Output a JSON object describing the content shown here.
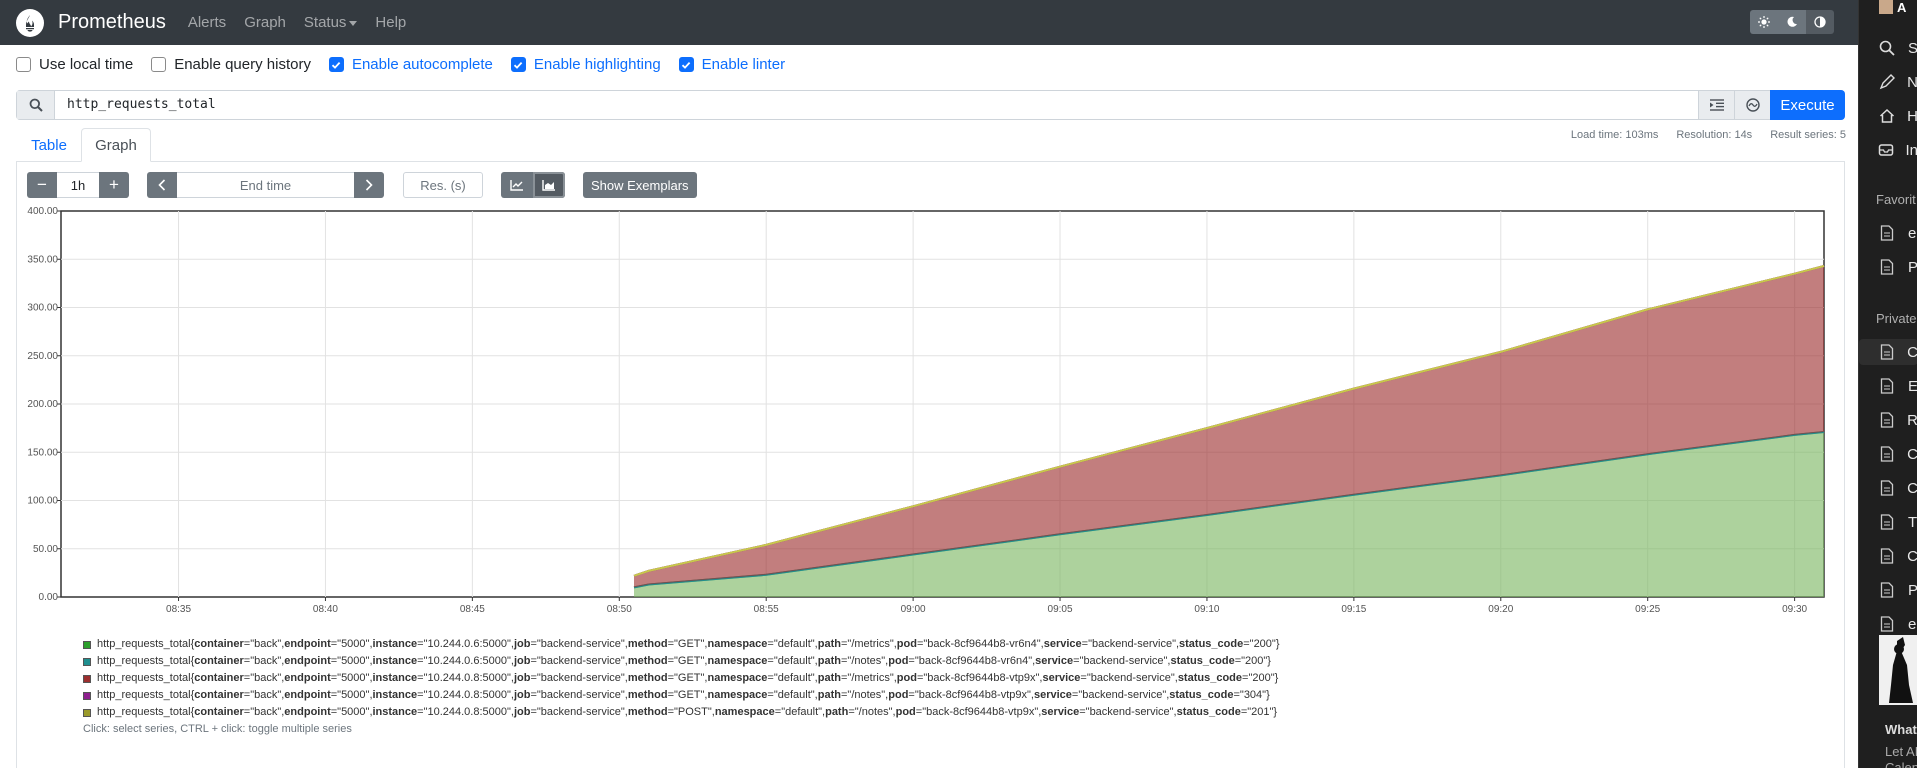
{
  "navbar": {
    "brand": "Prometheus",
    "links": [
      "Alerts",
      "Graph",
      "Status",
      "Help"
    ],
    "theme_icons": [
      "sun-icon",
      "moon-icon",
      "contrast-icon"
    ]
  },
  "options": [
    {
      "label": "Use local time",
      "checked": false
    },
    {
      "label": "Enable query history",
      "checked": false
    },
    {
      "label": "Enable autocomplete",
      "checked": true
    },
    {
      "label": "Enable highlighting",
      "checked": true
    },
    {
      "label": "Enable linter",
      "checked": true
    }
  ],
  "query": {
    "expression": "http_requests_total",
    "execute_label": "Execute"
  },
  "stats": {
    "load_time": "Load time: 103ms",
    "resolution": "Resolution: 14s",
    "result_series": "Result series: 5"
  },
  "tabs": {
    "table": "Table",
    "graph": "Graph"
  },
  "controls": {
    "minus": "−",
    "range": "1h",
    "plus": "+",
    "end_time_placeholder": "End time",
    "resolution_placeholder": "Res. (s)",
    "show_exemplars": "Show Exemplars"
  },
  "chart_data": {
    "type": "area",
    "stacked": true,
    "grid": true,
    "ylim": [
      0,
      400
    ],
    "yticks": [
      "0.00",
      "50.00",
      "100.00",
      "150.00",
      "200.00",
      "250.00",
      "300.00",
      "350.00",
      "400.00"
    ],
    "xlim": [
      "08:31",
      "09:31"
    ],
    "xticks": [
      "08:35",
      "08:40",
      "08:45",
      "08:50",
      "08:55",
      "09:00",
      "09:05",
      "09:10",
      "09:15",
      "09:20",
      "09:25",
      "09:30"
    ],
    "x": [
      "08:50:30",
      "08:51",
      "08:55",
      "09:00",
      "09:05",
      "09:10",
      "09:15",
      "09:20",
      "09:25",
      "09:30",
      "09:31"
    ],
    "series": [
      {
        "color": "#7bb661",
        "values": [
          10,
          13,
          23,
          44,
          65,
          85,
          106,
          126,
          148,
          168,
          171
        ]
      },
      {
        "color": "#1f8f8f",
        "values": [
          0,
          0,
          0,
          0,
          0,
          0,
          0,
          0,
          0,
          0,
          0
        ]
      },
      {
        "color": "#9c2f2f",
        "values": [
          12,
          14,
          31,
          50,
          70,
          90,
          110,
          128,
          150,
          167,
          172
        ]
      },
      {
        "color": "#8e44ad",
        "values": [
          0,
          0,
          0,
          0,
          0,
          0,
          0,
          0,
          0,
          0,
          0
        ]
      },
      {
        "color": "#c8c84b",
        "values": [
          0,
          0,
          0,
          0,
          0,
          0,
          0,
          0,
          0,
          0,
          0
        ]
      }
    ]
  },
  "legend": {
    "metric": "http_requests_total",
    "rows": [
      {
        "color": "#2ca02c",
        "labels": [
          [
            "container",
            "back"
          ],
          [
            "endpoint",
            "5000"
          ],
          [
            "instance",
            "10.244.0.6:5000"
          ],
          [
            "job",
            "backend-service"
          ],
          [
            "method",
            "GET"
          ],
          [
            "namespace",
            "default"
          ],
          [
            "path",
            "/metrics"
          ],
          [
            "pod",
            "back-8cf9644b8-vr6n4"
          ],
          [
            "service",
            "backend-service"
          ],
          [
            "status_code",
            "200"
          ]
        ]
      },
      {
        "color": "#1f8f8f",
        "labels": [
          [
            "container",
            "back"
          ],
          [
            "endpoint",
            "5000"
          ],
          [
            "instance",
            "10.244.0.6:5000"
          ],
          [
            "job",
            "backend-service"
          ],
          [
            "method",
            "GET"
          ],
          [
            "namespace",
            "default"
          ],
          [
            "path",
            "/notes"
          ],
          [
            "pod",
            "back-8cf9644b8-vr6n4"
          ],
          [
            "service",
            "backend-service"
          ],
          [
            "status_code",
            "200"
          ]
        ]
      },
      {
        "color": "#9c2f2f",
        "labels": [
          [
            "container",
            "back"
          ],
          [
            "endpoint",
            "5000"
          ],
          [
            "instance",
            "10.244.0.8:5000"
          ],
          [
            "job",
            "backend-service"
          ],
          [
            "method",
            "GET"
          ],
          [
            "namespace",
            "default"
          ],
          [
            "path",
            "/metrics"
          ],
          [
            "pod",
            "back-8cf9644b8-vtp9x"
          ],
          [
            "service",
            "backend-service"
          ],
          [
            "status_code",
            "200"
          ]
        ]
      },
      {
        "color": "#8e1f8e",
        "labels": [
          [
            "container",
            "back"
          ],
          [
            "endpoint",
            "5000"
          ],
          [
            "instance",
            "10.244.0.8:5000"
          ],
          [
            "job",
            "backend-service"
          ],
          [
            "method",
            "GET"
          ],
          [
            "namespace",
            "default"
          ],
          [
            "path",
            "/notes"
          ],
          [
            "pod",
            "back-8cf9644b8-vtp9x"
          ],
          [
            "service",
            "backend-service"
          ],
          [
            "status_code",
            "304"
          ]
        ]
      },
      {
        "color": "#9a9a2a",
        "labels": [
          [
            "container",
            "back"
          ],
          [
            "endpoint",
            "5000"
          ],
          [
            "instance",
            "10.244.0.8:5000"
          ],
          [
            "job",
            "backend-service"
          ],
          [
            "method",
            "POST"
          ],
          [
            "namespace",
            "default"
          ],
          [
            "path",
            "/notes"
          ],
          [
            "pod",
            "back-8cf9644b8-vtp9x"
          ],
          [
            "service",
            "backend-service"
          ],
          [
            "status_code",
            "201"
          ]
        ]
      }
    ],
    "hint": "Click: select series, CTRL + click: toggle multiple series"
  },
  "side_panel": {
    "top_items": [
      {
        "icon": "search-icon",
        "text": "S"
      },
      {
        "icon": "pen-icon",
        "text": "N"
      },
      {
        "icon": "home-icon",
        "text": "H"
      },
      {
        "icon": "inbox-icon",
        "text": "In"
      }
    ],
    "favorites_heading": "Favorit",
    "favorites": [
      "e",
      "P"
    ],
    "private_heading": "Private",
    "private_items": [
      "C",
      "E",
      "R",
      "C",
      "C",
      "T",
      "C",
      "P",
      "e"
    ],
    "bottom_title": "What",
    "bottom_lines": [
      "Let AI",
      "Calen"
    ],
    "avatar_text": "A"
  }
}
